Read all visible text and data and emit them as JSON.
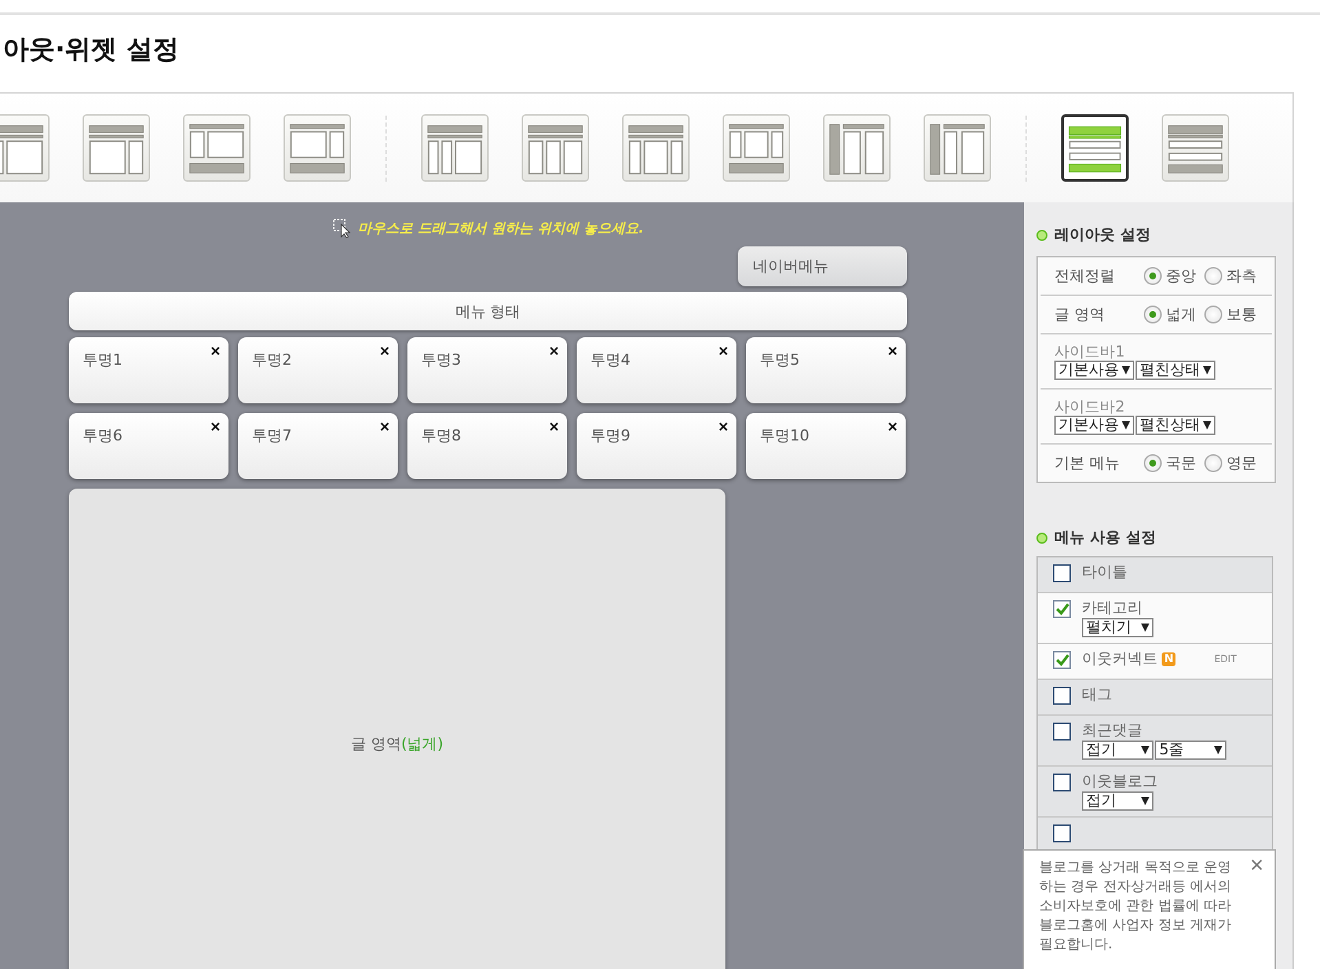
{
  "page_title": "아웃·위젯 설정",
  "layout_templates": [
    {
      "kind": "left2",
      "selected": false
    },
    {
      "kind": "right2",
      "selected": false
    },
    {
      "kind": "left2f",
      "selected": false
    },
    {
      "kind": "right2f",
      "selected": false
    },
    {
      "kind": "left3",
      "selected": false
    },
    {
      "kind": "even3",
      "selected": false
    },
    {
      "kind": "center3",
      "selected": false
    },
    {
      "kind": "center3f",
      "selected": false
    },
    {
      "kind": "bar3",
      "selected": false
    },
    {
      "kind": "bar3b",
      "selected": false
    },
    {
      "kind": "stack",
      "selected": true
    },
    {
      "kind": "stack",
      "selected": false
    }
  ],
  "canvas": {
    "hint": "마우스로 드래그해서 원하는 위치에 놓으세요.",
    "top_menu": "네이버메뉴",
    "menu_bar": "메뉴 형태",
    "widgets": [
      {
        "label": "투명1",
        "close": "×"
      },
      {
        "label": "투명2",
        "close": "×"
      },
      {
        "label": "투명3",
        "close": "×"
      },
      {
        "label": "투명4",
        "close": "×"
      },
      {
        "label": "투명5",
        "close": "×"
      },
      {
        "label": "투명6",
        "close": "×"
      },
      {
        "label": "투명7",
        "close": "×"
      },
      {
        "label": "투명8",
        "close": "×"
      },
      {
        "label": "투명9",
        "close": "×"
      },
      {
        "label": "투명10",
        "close": "×"
      }
    ],
    "content_area": {
      "label": "글 영역",
      "mode": "(넓게)"
    }
  },
  "layout_settings": {
    "title": "레이아웃 설정",
    "rows": [
      {
        "kind": "radio",
        "label": "전체정렬",
        "options": [
          {
            "label": "중앙",
            "selected": true
          },
          {
            "label": "좌측",
            "selected": false
          }
        ]
      },
      {
        "kind": "radio",
        "label": "글 영역",
        "options": [
          {
            "label": "넓게",
            "selected": true
          },
          {
            "label": "보통",
            "selected": false
          }
        ]
      },
      {
        "kind": "select",
        "label": "사이드바1",
        "selects": [
          "기본사용",
          "펼친상태"
        ]
      },
      {
        "kind": "select",
        "label": "사이드바2",
        "selects": [
          "기본사용",
          "펼친상태"
        ]
      },
      {
        "kind": "radio",
        "label": "기본 메뉴",
        "options": [
          {
            "label": "국문",
            "selected": true
          },
          {
            "label": "영문",
            "selected": false
          }
        ]
      }
    ]
  },
  "menu_settings": {
    "title": "메뉴 사용 설정",
    "items": [
      {
        "label": "타이틀",
        "checked": false
      },
      {
        "label": "카테고리",
        "checked": true,
        "selects": [
          "펼치기"
        ]
      },
      {
        "label": "이웃커넥트",
        "checked": true,
        "badge": "N",
        "edit": "EDIT"
      },
      {
        "label": "태그",
        "checked": false
      },
      {
        "label": "최근댓글",
        "checked": false,
        "selects": [
          "접기",
          "5줄"
        ]
      },
      {
        "label": "이웃블로그",
        "checked": false,
        "selects": [
          "접기"
        ]
      },
      {
        "checked": false
      }
    ]
  },
  "notice": {
    "text": "블로그를 상거래 목적으로 운영하는 경우 전자상거래등 에서의 소비자보호에 관한 법률에 따라 블로그홈에 사업자 정보 게재가 필요합니다.",
    "close": "×"
  }
}
